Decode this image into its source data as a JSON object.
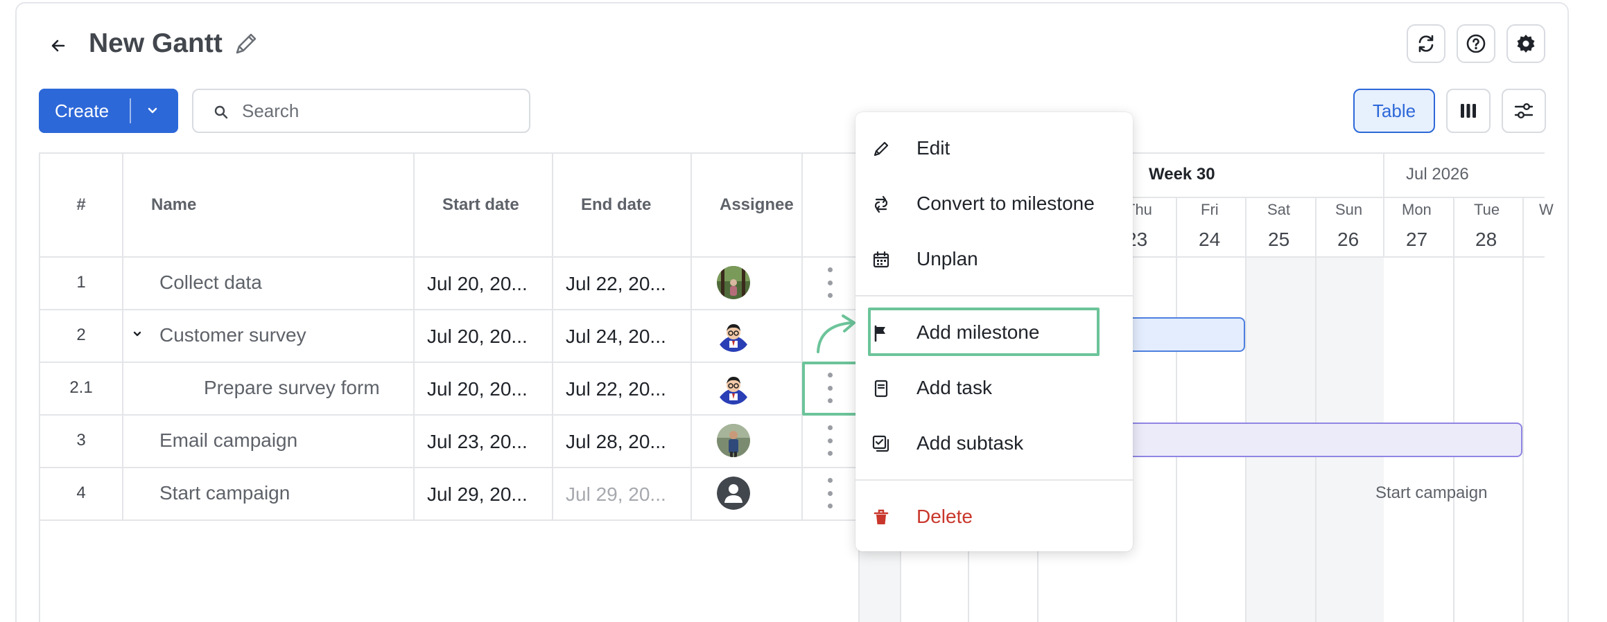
{
  "header": {
    "title": "New Gantt",
    "icons": [
      "back-arrow-icon",
      "pencil-icon",
      "sync-icon",
      "help-icon",
      "gear-icon"
    ]
  },
  "toolbar": {
    "create_label": "Create",
    "search_placeholder": "Search",
    "view_table_label": "Table"
  },
  "table": {
    "columns": [
      "#",
      "Name",
      "Start date",
      "End date",
      "Assignee"
    ],
    "rows": [
      {
        "num": "1",
        "name": "Collect data",
        "start": "Jul 20, 20...",
        "end": "Jul 22, 20...",
        "avatar": "photo-forest"
      },
      {
        "num": "2",
        "name": "Customer survey",
        "start": "Jul 20, 20...",
        "end": "Jul 24, 20...",
        "avatar": "cartoon-glasses",
        "expandable": true
      },
      {
        "num": "2.1",
        "name": "Prepare survey form",
        "start": "Jul 20, 20...",
        "end": "Jul 22, 20...",
        "avatar": "cartoon-glasses"
      },
      {
        "num": "3",
        "name": "Email campaign",
        "start": "Jul 23, 20...",
        "end": "Jul 28, 20...",
        "avatar": "photo-person"
      },
      {
        "num": "4",
        "name": "Start campaign",
        "start": "Jul 29, 20...",
        "end": "Jul 29, 20...",
        "end_muted": true,
        "avatar": "default-user"
      }
    ]
  },
  "timeline": {
    "week_label": "Week 30",
    "month_label": "Jul 2026",
    "days": [
      {
        "dow": "Thu",
        "day": "23"
      },
      {
        "dow": "Fri",
        "day": "24"
      },
      {
        "dow": "Sat",
        "day": "25"
      },
      {
        "dow": "Sun",
        "day": "26"
      },
      {
        "dow": "Mon",
        "day": "27"
      },
      {
        "dow": "Tue",
        "day": "28"
      },
      {
        "dow": "W",
        "day": ""
      }
    ],
    "milestone_label": "Start campaign",
    "colors": {
      "survey_bar": "#e3edfd",
      "survey_border": "#4d7fe0",
      "email_bar": "#ecebfa",
      "email_border": "#8f85e3"
    }
  },
  "menu": {
    "items": [
      {
        "label": "Edit",
        "icon": "pencil-icon"
      },
      {
        "label": "Convert to milestone",
        "icon": "convert-icon"
      },
      {
        "label": "Unplan",
        "icon": "calendar-icon"
      },
      {
        "label": "Add milestone",
        "icon": "flag-icon"
      },
      {
        "label": "Add task",
        "icon": "task-icon"
      },
      {
        "label": "Add subtask",
        "icon": "subtask-icon"
      },
      {
        "label": "Delete",
        "icon": "trash-icon"
      }
    ]
  },
  "colors": {
    "accent": "#2d68d8",
    "highlight": "#6cc49a",
    "danger": "#c9372c"
  }
}
